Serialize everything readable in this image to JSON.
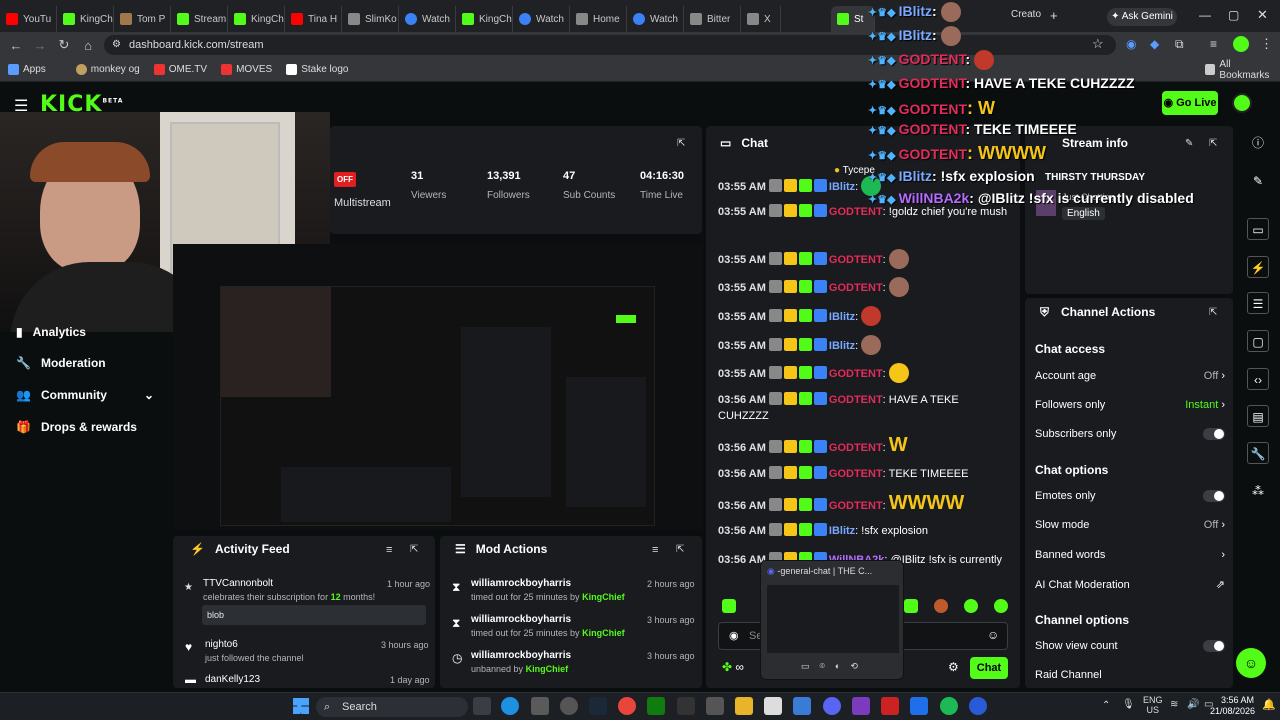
{
  "browser": {
    "tabs": [
      "YouTu",
      "KingCh",
      "Tom P",
      "Stream",
      "KingCh",
      "Tina H",
      "SlimKo",
      "Watch",
      "KingCh",
      "Watch",
      "Home",
      "Watch",
      "Bitter",
      "X",
      "St",
      "Expl",
      "Creato"
    ],
    "url": "dashboard.kick.com/stream",
    "ask_gemini": "Ask Gemini",
    "bookmarks": [
      "Apps",
      "monkey og",
      "OME.TV",
      "MOVES",
      "Stake logo"
    ],
    "all_bookmarks": "All Bookmarks"
  },
  "kick": {
    "logo": "KICK",
    "beta": "BETA",
    "go_live": "Go Live"
  },
  "sidebar": {
    "items": [
      {
        "label": "Analytics",
        "icon": "chart-icon"
      },
      {
        "label": "Moderation",
        "icon": "wrench-icon"
      },
      {
        "label": "Community",
        "icon": "people-icon"
      },
      {
        "label": "Drops & rewards",
        "icon": "gift-icon"
      }
    ]
  },
  "stats": {
    "status": "OFF",
    "status_label": "Multistream",
    "viewers": "31",
    "viewers_label": "Viewers",
    "followers": "13,391",
    "followers_label": "Followers",
    "subs": "47",
    "subs_label": "Sub Counts",
    "time": "04:16:30",
    "time_label": "Time Live"
  },
  "chat": {
    "title": "Chat",
    "pinned_user": "Tycepe",
    "lines": [
      {
        "time": "03:55 AM",
        "user": "IBlitz",
        "color": "blue",
        "text": ""
      },
      {
        "time": "03:55 AM",
        "user": "GODTENT",
        "color": "red",
        "text": "!goldz chief you're mush"
      },
      {
        "time": "03:55 AM",
        "user": "GODTENT",
        "color": "red",
        "text": ""
      },
      {
        "time": "03:55 AM",
        "user": "GODTENT",
        "color": "red",
        "text": ""
      },
      {
        "time": "03:55 AM",
        "user": "IBlitz",
        "color": "blue",
        "text": ""
      },
      {
        "time": "03:55 AM",
        "user": "IBlitz",
        "color": "blue",
        "text": ""
      },
      {
        "time": "03:55 AM",
        "user": "GODTENT",
        "color": "red",
        "text": ""
      },
      {
        "time": "03:56 AM",
        "user": "GODTENT",
        "color": "red",
        "text": "HAVE A TEKE CUHZZZZ"
      },
      {
        "time": "03:56 AM",
        "user": "GODTENT",
        "color": "red",
        "text": "W"
      },
      {
        "time": "03:56 AM",
        "user": "GODTENT",
        "color": "red",
        "text": "TEKE TIMEEEE"
      },
      {
        "time": "03:56 AM",
        "user": "GODTENT",
        "color": "red",
        "text": "WWWW"
      },
      {
        "time": "03:56 AM",
        "user": "IBlitz",
        "color": "blue",
        "text": "!sfx explosion"
      },
      {
        "time": "03:56 AM",
        "user": "WillNBA2k",
        "color": "purple",
        "text": "@IBlitz !sfx is currently"
      }
    ],
    "input_placeholder": "Se",
    "send_button": "Chat",
    "extra_text": "∞"
  },
  "stream_info": {
    "title": "Stream info",
    "stream_title": "THIRSTY THURSDAY",
    "category": "Just Chatting",
    "language": "English"
  },
  "channel_actions": {
    "title": "Channel Actions",
    "chat_access": "Chat access",
    "account_age": "Account age",
    "account_age_value": "Off",
    "followers_only": "Followers only",
    "followers_only_value": "Instant",
    "subscribers_only": "Subscribers only",
    "chat_options": "Chat options",
    "emotes_only": "Emotes only",
    "slow_mode": "Slow mode",
    "slow_mode_value": "Off",
    "banned_words": "Banned words",
    "ai_moderation": "AI Chat Moderation",
    "channel_options": "Channel options",
    "show_view_count": "Show view count",
    "raid_channel": "Raid Channel"
  },
  "activity_feed": {
    "title": "Activity Feed",
    "items": [
      {
        "user": "TTVCannonbolt",
        "detail": "celebrates their subscription for",
        "count": "12",
        "suffix": "months!",
        "time": "1 hour ago",
        "message": "blob"
      },
      {
        "user": "nighto6",
        "detail": "just followed the channel",
        "time": "3 hours ago"
      },
      {
        "user": "danKelly123",
        "detail": "",
        "time": "1 day ago"
      }
    ]
  },
  "mod_actions": {
    "title": "Mod Actions",
    "items": [
      {
        "user": "williamrockboyharris",
        "action": "timed out for 25 minutes by",
        "mod": "KingChief",
        "time": "2 hours ago"
      },
      {
        "user": "williamrockboyharris",
        "action": "timed out for 25 minutes by",
        "mod": "KingChief",
        "time": "3 hours ago"
      },
      {
        "user": "williamrockboyharris",
        "action": "unbanned by",
        "mod": "KingChief",
        "time": "3 hours ago"
      }
    ]
  },
  "overlay": {
    "lines": [
      {
        "user": "IBlitz",
        "text": ""
      },
      {
        "user": "IBlitz",
        "text": ""
      },
      {
        "user": "GODTENT",
        "text": ""
      },
      {
        "user": "GODTENT",
        "text": "HAVE A TEKE CUHZZZZ"
      },
      {
        "user": "GODTENT",
        "text": "W"
      },
      {
        "user": "GODTENT",
        "text": "TEKE TIMEEEE"
      },
      {
        "user": "GODTENT",
        "text": "WWWW"
      },
      {
        "user": "IBlitz",
        "text": "!sfx explosion"
      },
      {
        "user": "WillNBA2k",
        "text": "@IBlitz !sfx is currently disabled"
      }
    ]
  },
  "discord_popup": {
    "title": "-general-chat | THE C..."
  },
  "taskbar": {
    "search": "Search",
    "lang": "ENG",
    "region": "US",
    "time": "3:56 AM",
    "date": "21/08/2026"
  },
  "colors": {
    "kick_green": "#53fc18",
    "red_name": "#e22c5b",
    "blue_name": "#7aa9ff",
    "purple_name": "#b56bff"
  }
}
